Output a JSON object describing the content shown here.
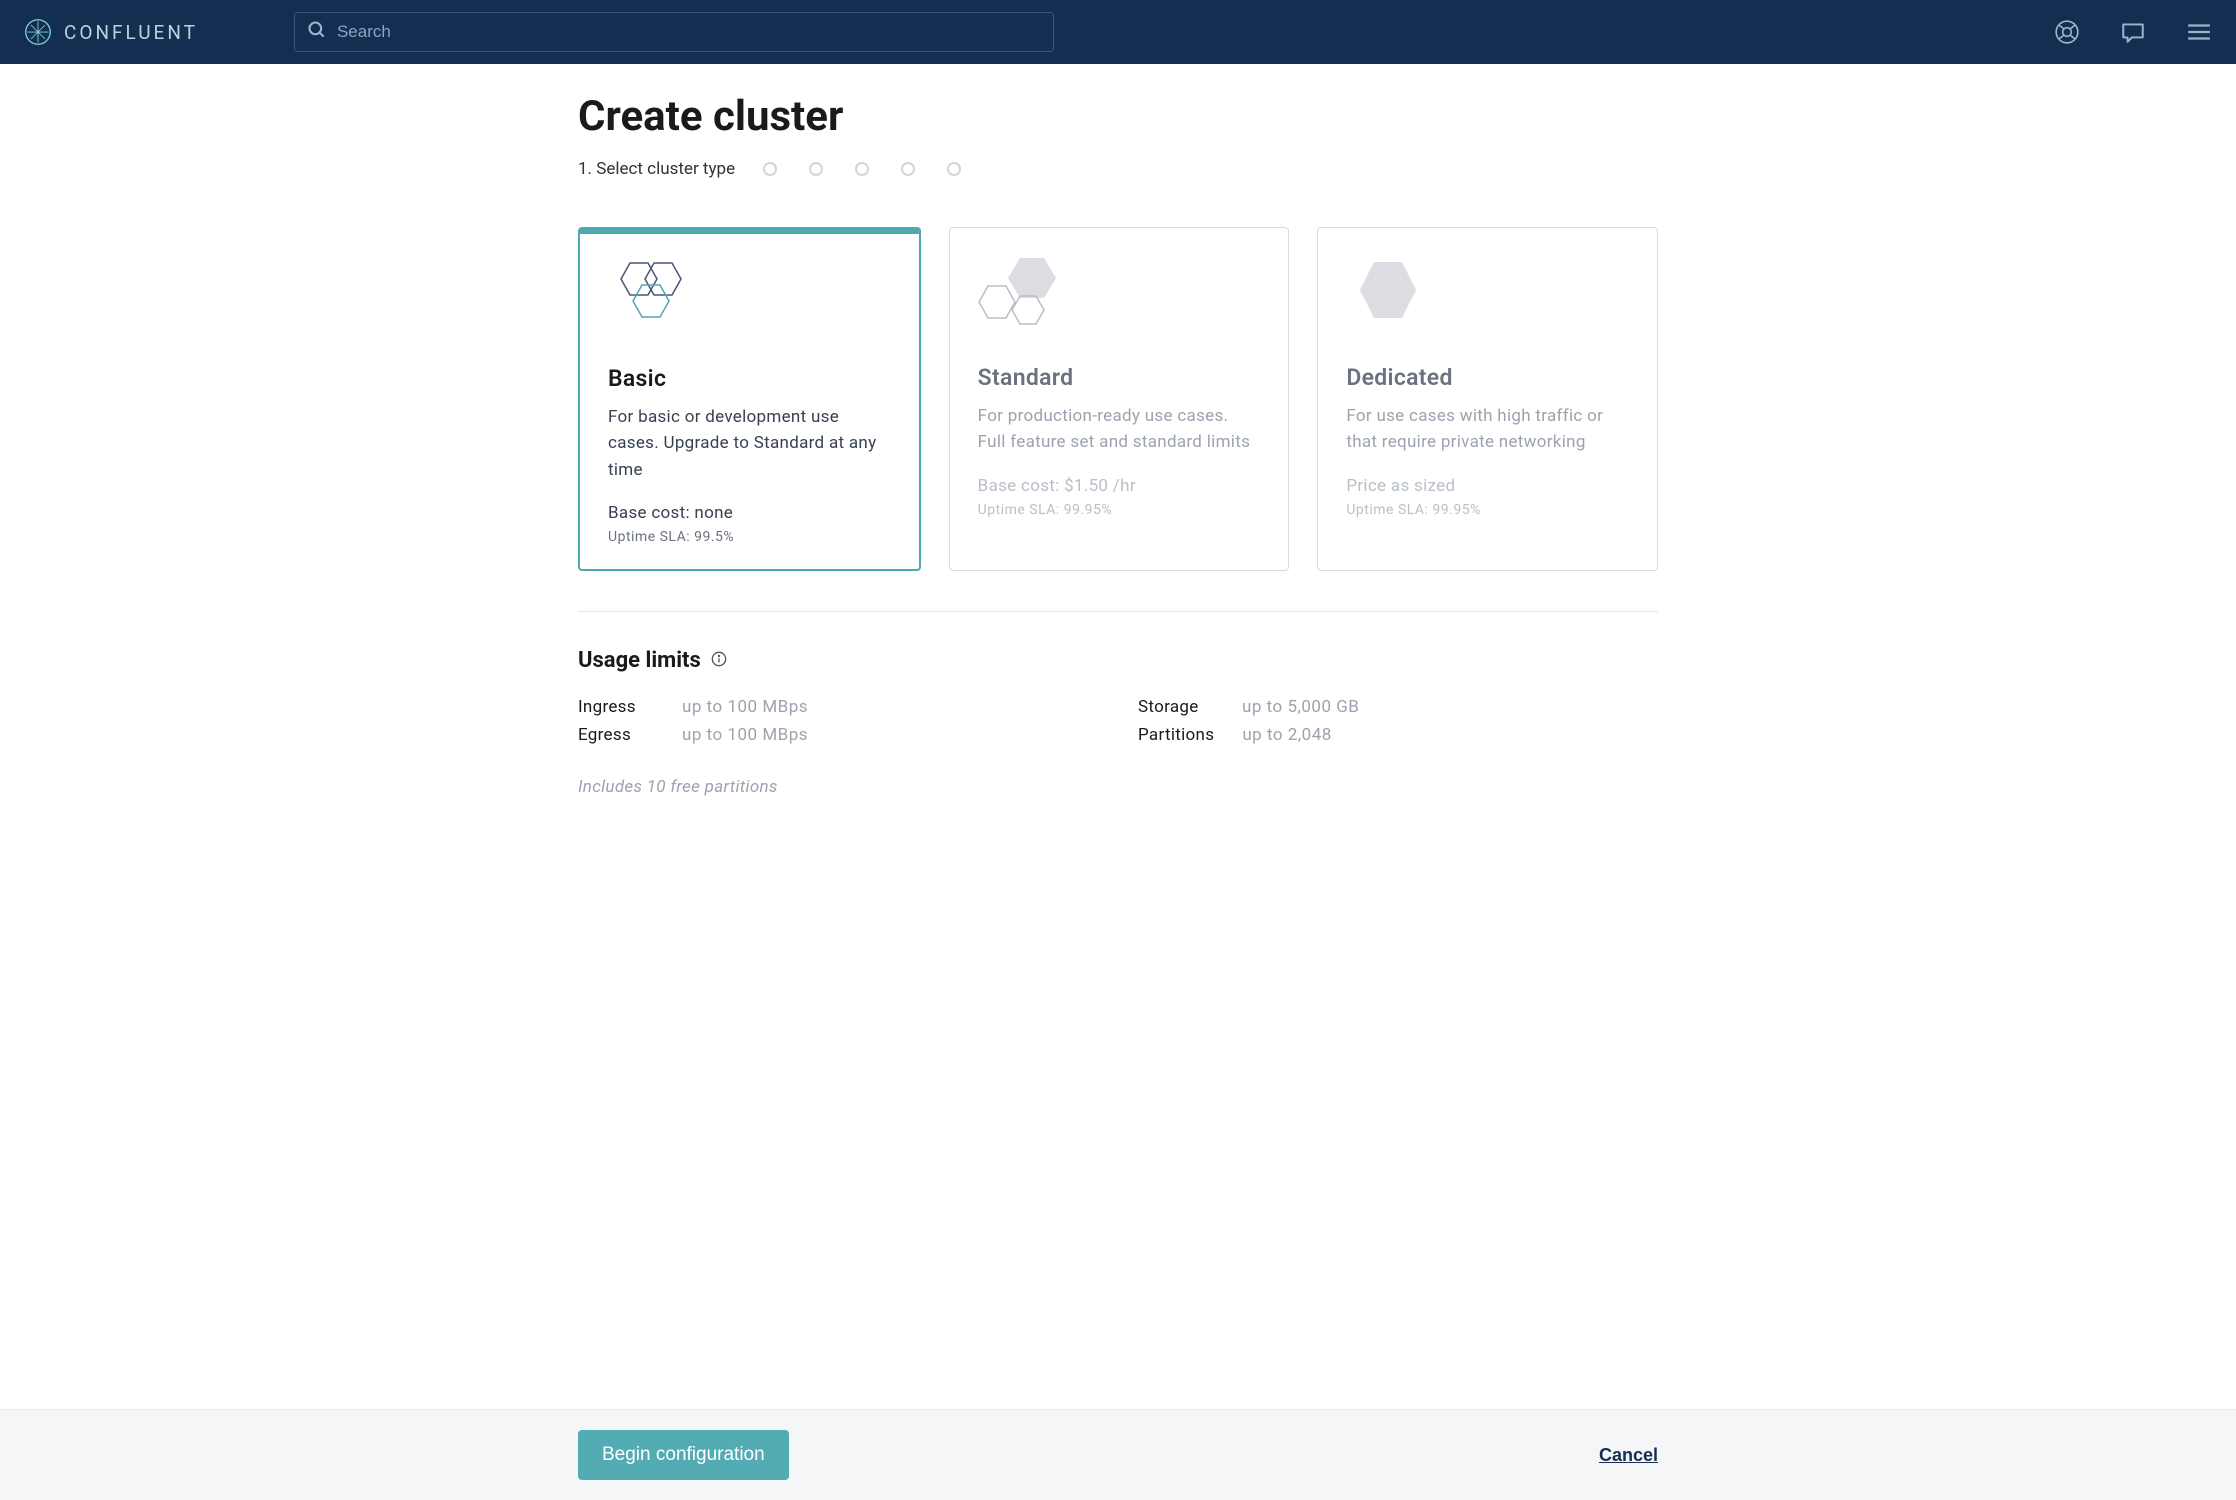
{
  "header": {
    "brand_text": "CONFLUENT",
    "search_placeholder": "Search"
  },
  "page": {
    "title": "Create cluster",
    "step_label": "1. Select cluster type"
  },
  "cards": [
    {
      "title": "Basic",
      "desc": "For basic or development use cases. Upgrade to Standard at any time",
      "cost": "Base cost: none",
      "sla": "Uptime SLA: 99.5%",
      "selected": true
    },
    {
      "title": "Standard",
      "desc": "For production-ready use cases. Full feature set and standard limits",
      "cost": "Base cost: $1.50 /hr",
      "sla": "Uptime SLA: 99.95%",
      "selected": false
    },
    {
      "title": "Dedicated",
      "desc": "For use cases with high traffic or that require private networking",
      "cost": "Price as sized",
      "sla": "Uptime SLA: 99.95%",
      "selected": false
    }
  ],
  "usage": {
    "title": "Usage limits",
    "items": [
      {
        "label": "Ingress",
        "value": "up to 100 MBps"
      },
      {
        "label": "Storage",
        "value": "up to 5,000 GB"
      },
      {
        "label": "Egress",
        "value": "up to 100 MBps"
      },
      {
        "label": "Partitions",
        "value": "up to 2,048"
      }
    ],
    "note": "Includes 10 free partitions"
  },
  "footer": {
    "begin_label": "Begin configuration",
    "cancel_label": "Cancel"
  }
}
